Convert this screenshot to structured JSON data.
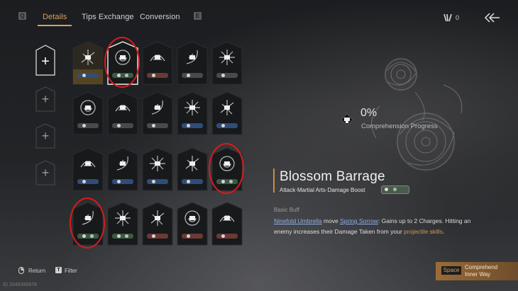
{
  "topbar": {
    "left_key": "Q",
    "tabs": [
      {
        "label": "Details",
        "active": true
      },
      {
        "label": "Tips Exchange",
        "active": false
      },
      {
        "label": "Conversion",
        "active": false
      }
    ],
    "right_key": "E",
    "currency_icon": "bamboo-token-icon",
    "currency_count": "0",
    "back_icon": "back-arrow-icon"
  },
  "slots": [
    {
      "selected": true,
      "symbol": "+"
    },
    {
      "selected": false,
      "symbol": "+"
    },
    {
      "selected": false,
      "symbol": "+"
    },
    {
      "selected": false,
      "symbol": "+"
    }
  ],
  "grid": {
    "rows": [
      [
        {
          "icon": "fan-blades-icon",
          "badge": "blue",
          "gold": true
        },
        {
          "icon": "orb-swirl-icon",
          "badge": "green",
          "selected": true,
          "highlight": true
        },
        {
          "icon": "cloud-beast-icon",
          "badge": "red"
        },
        {
          "icon": "crescent-strike-icon",
          "badge": "grey"
        },
        {
          "icon": "starburst-icon",
          "badge": "grey"
        }
      ],
      [
        {
          "icon": "crossed-blades-icon",
          "badge": "grey"
        },
        {
          "icon": "guardian-figure-icon",
          "badge": "grey"
        },
        {
          "icon": "dragon-coil-icon",
          "badge": "grey"
        },
        {
          "icon": "beast-head-icon",
          "badge": "blue"
        },
        {
          "icon": "crescent-moon-icon",
          "badge": "blue"
        }
      ],
      [
        {
          "icon": "koi-fish-icon",
          "badge": "blue"
        },
        {
          "icon": "masked-warrior-icon",
          "badge": "blue"
        },
        {
          "icon": "hooded-monk-icon",
          "badge": "blue"
        },
        {
          "icon": "umbrella-arc-icon",
          "badge": "blue"
        },
        {
          "icon": "blossom-barrage-icon",
          "badge": "green",
          "highlight": true
        }
      ],
      [
        {
          "icon": "spirit-ring-icon",
          "badge": "green",
          "highlight": true
        },
        {
          "icon": "fan-circle-icon",
          "badge": "green"
        },
        {
          "icon": "swift-strike-icon",
          "badge": "red"
        },
        {
          "icon": "heavy-blade-icon",
          "badge": "red"
        },
        {
          "icon": "bell-tower-icon",
          "badge": "red"
        }
      ]
    ]
  },
  "detail": {
    "progress_icon": "comprehension-icon",
    "progress_percent": "0%",
    "progress_label": "Comprehension Progress",
    "title": "Blossom Barrage",
    "subtitle": "Attack·Martial Arts·Damage Boost",
    "section_label": "Basic Buff",
    "desc_link1": "Ninefold Umbrella",
    "desc_text1": " move ",
    "desc_link2": "Spring Sorrow",
    "desc_text2": ": Gains up to 2 Charges. Hitting an enemy increases their Damage Taken from your ",
    "desc_highlight": "projectile skills",
    "desc_text3": "."
  },
  "bottom": {
    "return_label": "Return",
    "filter_key": "T",
    "filter_label": "Filter",
    "uid": "ID 2048399978",
    "space_key": "Space",
    "comprehend_label": "Comprehend Inner Way"
  },
  "colors": {
    "accent": "#d7a35d",
    "badge_blue": "#2f4d7a",
    "badge_green": "#3d5a44",
    "badge_red": "#6a3a34",
    "badge_grey": "#4a4a4c",
    "highlight_ring": "#d51d1d"
  }
}
